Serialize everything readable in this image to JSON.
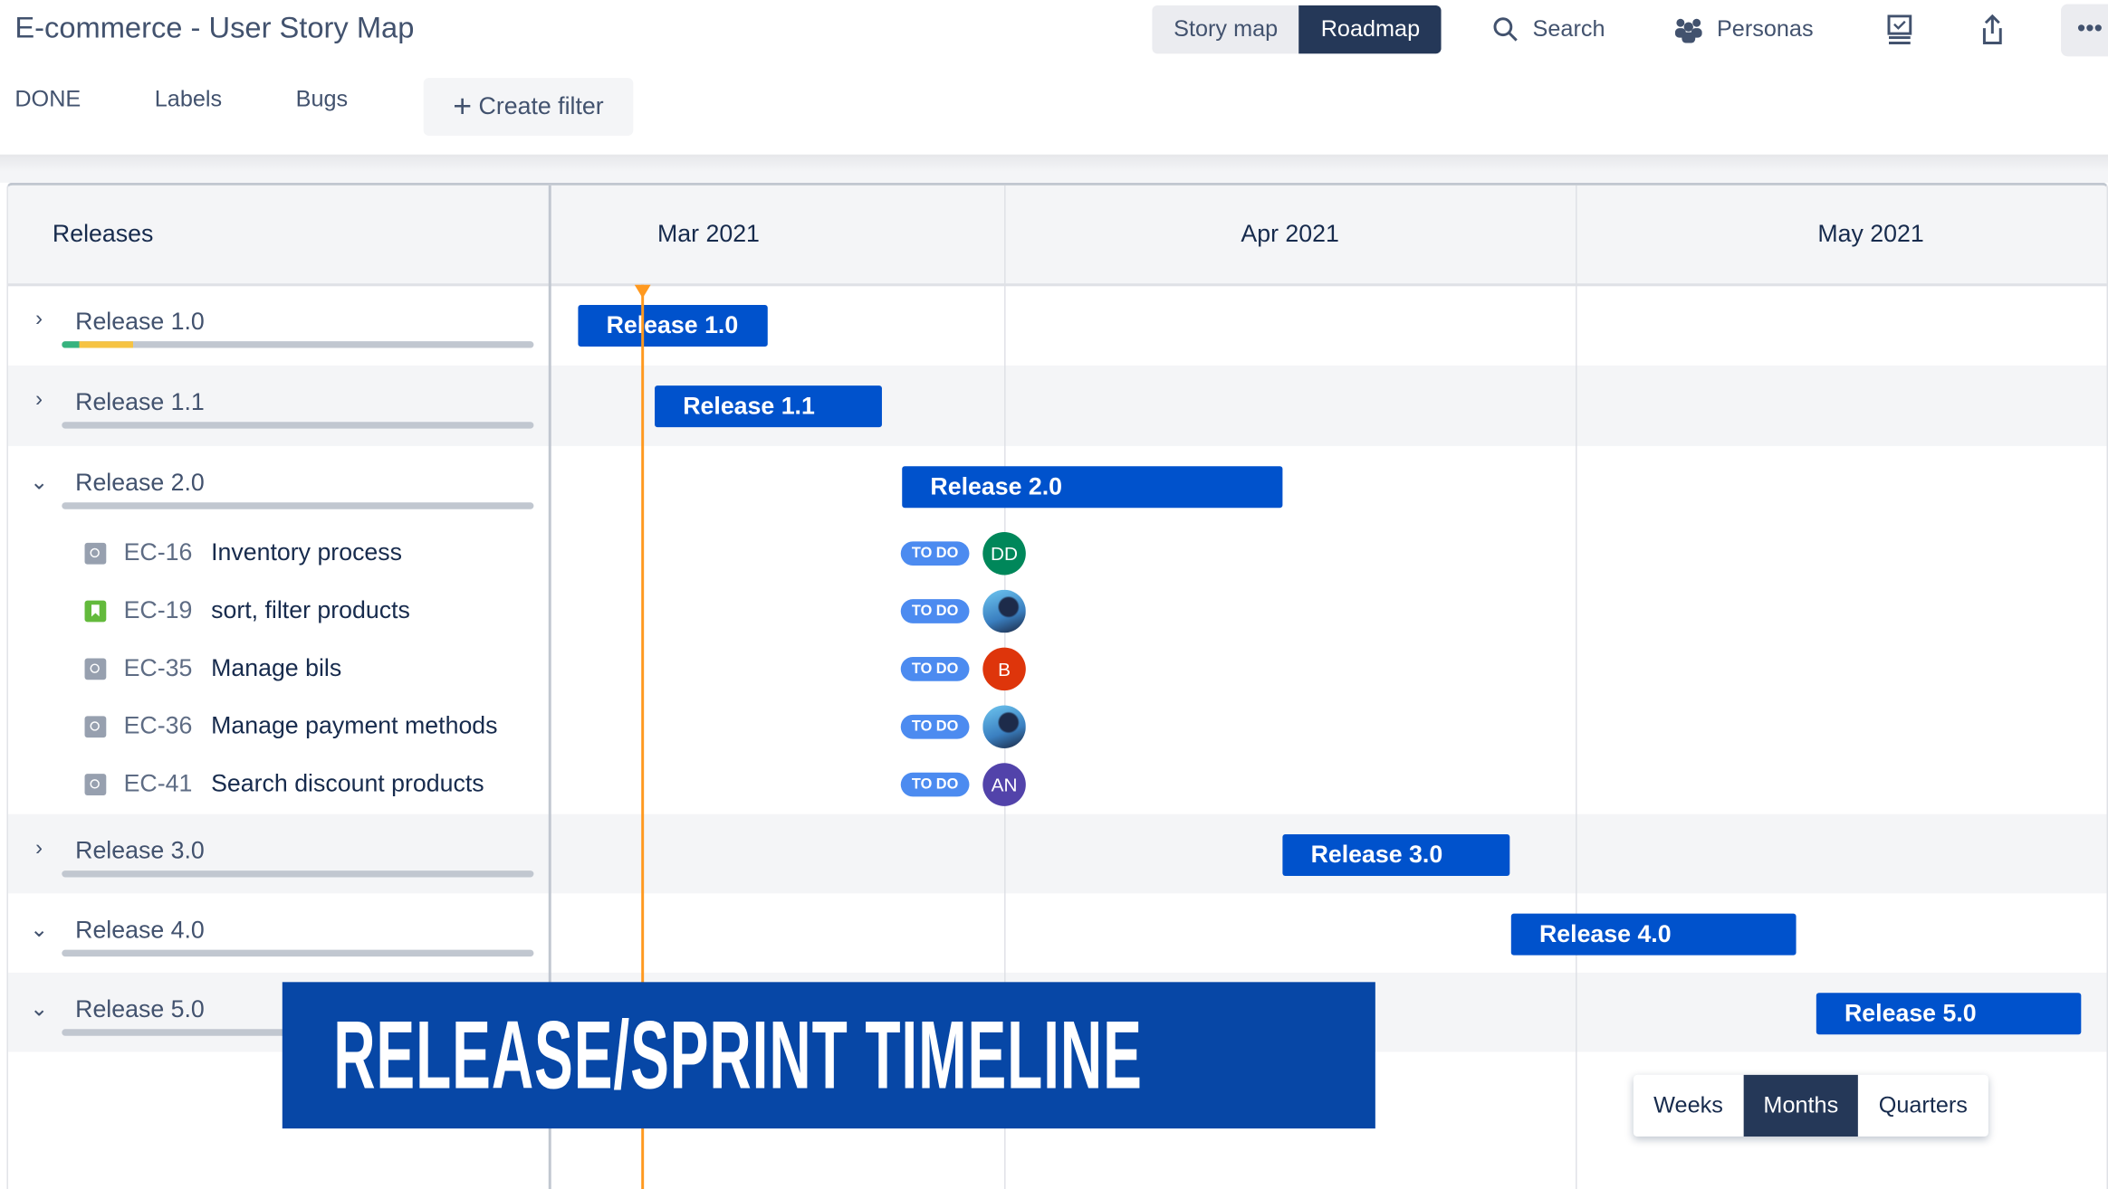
{
  "header": {
    "title": "E-commerce - User Story Map",
    "view_toggle": [
      {
        "label": "Story map",
        "active": false
      },
      {
        "label": "Roadmap",
        "active": true
      }
    ],
    "search_label": "Search",
    "personas_label": "Personas",
    "more_label": "•••"
  },
  "filters": {
    "items": [
      "DONE",
      "Labels",
      "Bugs"
    ],
    "create_filter_label": "Create filter"
  },
  "timeline": {
    "left_header": "Releases",
    "months": [
      "Mar 2021",
      "Apr 2021",
      "May 2021"
    ],
    "releases": [
      {
        "name": "Release 1.0",
        "bar_label": "Release 1.0",
        "expanded": false
      },
      {
        "name": "Release 1.1",
        "bar_label": "Release 1.1",
        "expanded": false
      },
      {
        "name": "Release 2.0",
        "bar_label": "Release 2.0",
        "expanded": true
      },
      {
        "name": "Release 3.0",
        "bar_label": "Release 3.0",
        "expanded": false
      },
      {
        "name": "Release 4.0",
        "bar_label": "Release 4.0",
        "expanded": true
      },
      {
        "name": "Release 5.0",
        "bar_label": "Release 5.0",
        "expanded": true
      }
    ],
    "issues": [
      {
        "key": "EC-16",
        "summary": "Inventory process",
        "type": "task",
        "status": "TO DO",
        "assignee": "DD",
        "avatar_color": "#00875a"
      },
      {
        "key": "EC-19",
        "summary": "sort, filter products",
        "type": "story",
        "status": "TO DO",
        "assignee": "",
        "avatar_color": "photo"
      },
      {
        "key": "EC-35",
        "summary": "Manage bils",
        "type": "task",
        "status": "TO DO",
        "assignee": "B",
        "avatar_color": "#de350b"
      },
      {
        "key": "EC-36",
        "summary": "Manage payment methods",
        "type": "task",
        "status": "TO DO",
        "assignee": "",
        "avatar_color": "photo"
      },
      {
        "key": "EC-41",
        "summary": "Search discount products",
        "type": "task",
        "status": "TO DO",
        "assignee": "AN",
        "avatar_color": "#5243aa"
      }
    ],
    "zoom_options": [
      {
        "label": "Weeks",
        "active": false
      },
      {
        "label": "Months",
        "active": true
      },
      {
        "label": "Quarters",
        "active": false
      }
    ]
  },
  "banner": {
    "text": "RELEASE/SPRINT TIMELINE"
  },
  "colors": {
    "accent": "#0052cc",
    "today_line": "#ff991f",
    "dark": "#253858",
    "banner": "#0747a6"
  }
}
